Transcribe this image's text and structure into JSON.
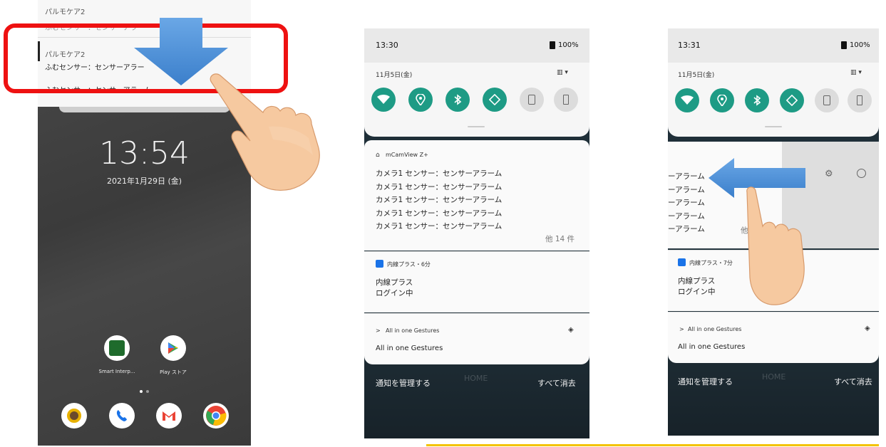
{
  "panel1": {
    "notif_app_top": "パルモケア2",
    "notif_app": "パルモケア2",
    "notif_line1": "ふむセンサー：センサーアラー",
    "notif_line2": "ふむセンサー：センサーアラーム",
    "clock": "13:54",
    "date": "2021年1月29日 (金)",
    "apps": [
      {
        "label": "Smart Interp...",
        "icon": "smart-interp-icon"
      },
      {
        "label": "Play ストア",
        "icon": "play-store-icon"
      }
    ],
    "dock": [
      "camera-icon",
      "phone-icon",
      "gmail-icon",
      "chrome-icon"
    ]
  },
  "panel2": {
    "time": "13:30",
    "battery": "100%",
    "date": "11月5日(金)",
    "quick_settings": [
      "wifi-icon",
      "location-icon",
      "bluetooth-icon",
      "auto-rotate-icon",
      "battery-saver-icon",
      "flashlight-icon"
    ],
    "app_header": "mCamView Z+",
    "lines": [
      "カメラ1 センサー：センサーアラーム",
      "カメラ1 センサー：センサーアラーム",
      "カメラ1 センサー：センサーアラーム",
      "カメラ1 センサー：センサーアラーム",
      "カメラ1 センサー：センサーアラーム"
    ],
    "more": "他 14 件",
    "naisen_header": "内線プラス・6分",
    "naisen_title": "内線プラス",
    "naisen_status": "ログイン中",
    "gestures_header": "All in one Gestures",
    "gestures_body": "All in one Gestures",
    "manage": "通知を管理する",
    "clear_all": "すべて消去",
    "home_ghost": "HOME"
  },
  "panel3": {
    "time": "13:31",
    "battery": "100%",
    "date": "11月5日(金)",
    "lines": [
      "ーアラーム",
      "ーアラーム",
      "ーアラーム",
      "ーアラーム",
      "ーアラーム"
    ],
    "more_fragment": "他",
    "naisen_header": "内線プラス・7分",
    "naisen_title": "内線プラス",
    "naisen_status": "ログイン中",
    "gestures_header": "All in one Gestures",
    "gestures_body": "All in one Gestures",
    "manage": "通知を管理する",
    "clear_all": "すべて消去",
    "home_ghost": "HOME"
  },
  "colors": {
    "highlight": "#ee1111",
    "arrow": "#4a90d9",
    "toggle_on": "#1e9b85",
    "accent_line": "#f3c300"
  }
}
